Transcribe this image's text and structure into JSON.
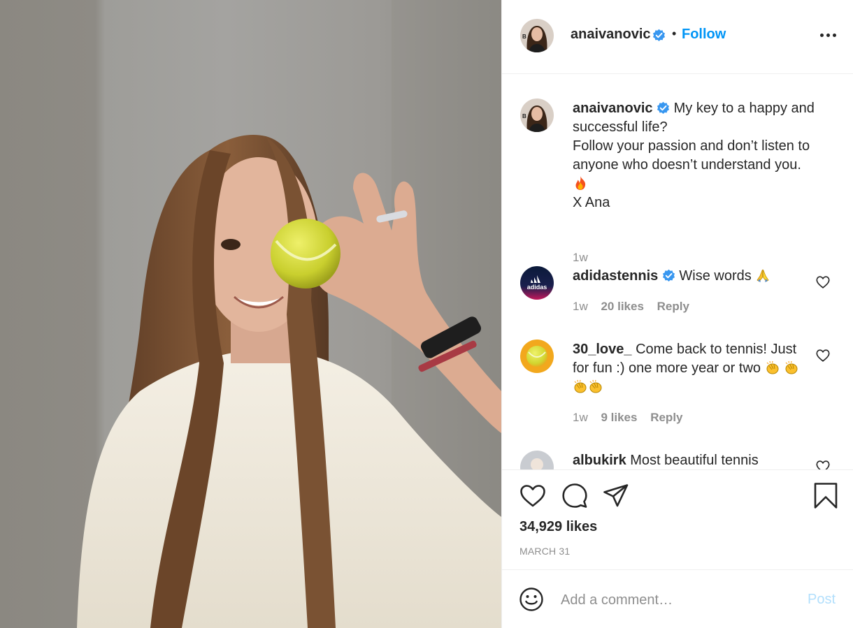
{
  "post": {
    "username": "anaivanovic",
    "follow_label": "Follow",
    "separator": "•",
    "more_label": "More options"
  },
  "caption": {
    "username": "anaivanovic",
    "line1": "My key to a happy and successful life?",
    "line2": "Follow your passion and don’t listen to anyone who doesn’t understand you.",
    "line3": "X Ana",
    "emoji_icon": "fire-icon",
    "time": "1w"
  },
  "comments": [
    {
      "username": "adidastennis",
      "verified": true,
      "text": "Wise words",
      "emoji_icon": "folded-hands-icon",
      "time": "1w",
      "likes": "20 likes",
      "reply": "Reply"
    },
    {
      "username": "30_love_",
      "verified": false,
      "text": "Come back to tennis! Just for fun :) one more year or two",
      "emoji_icon": "clapping-hands-icon",
      "time": "1w",
      "likes": "9 likes",
      "reply": "Reply"
    },
    {
      "username": "albukirk",
      "verified": false,
      "text": "Most beautiful tennis"
    }
  ],
  "actions": {
    "likes": "34,929 likes",
    "date": "MARCH 31"
  },
  "add_comment": {
    "placeholder": "Add a comment…",
    "post_label": "Post"
  },
  "colors": {
    "accent": "#0095f6",
    "post_disabled": "#b2dffc",
    "verified": "#3897f0",
    "text": "#262626",
    "secondary": "#8e8e8e"
  }
}
